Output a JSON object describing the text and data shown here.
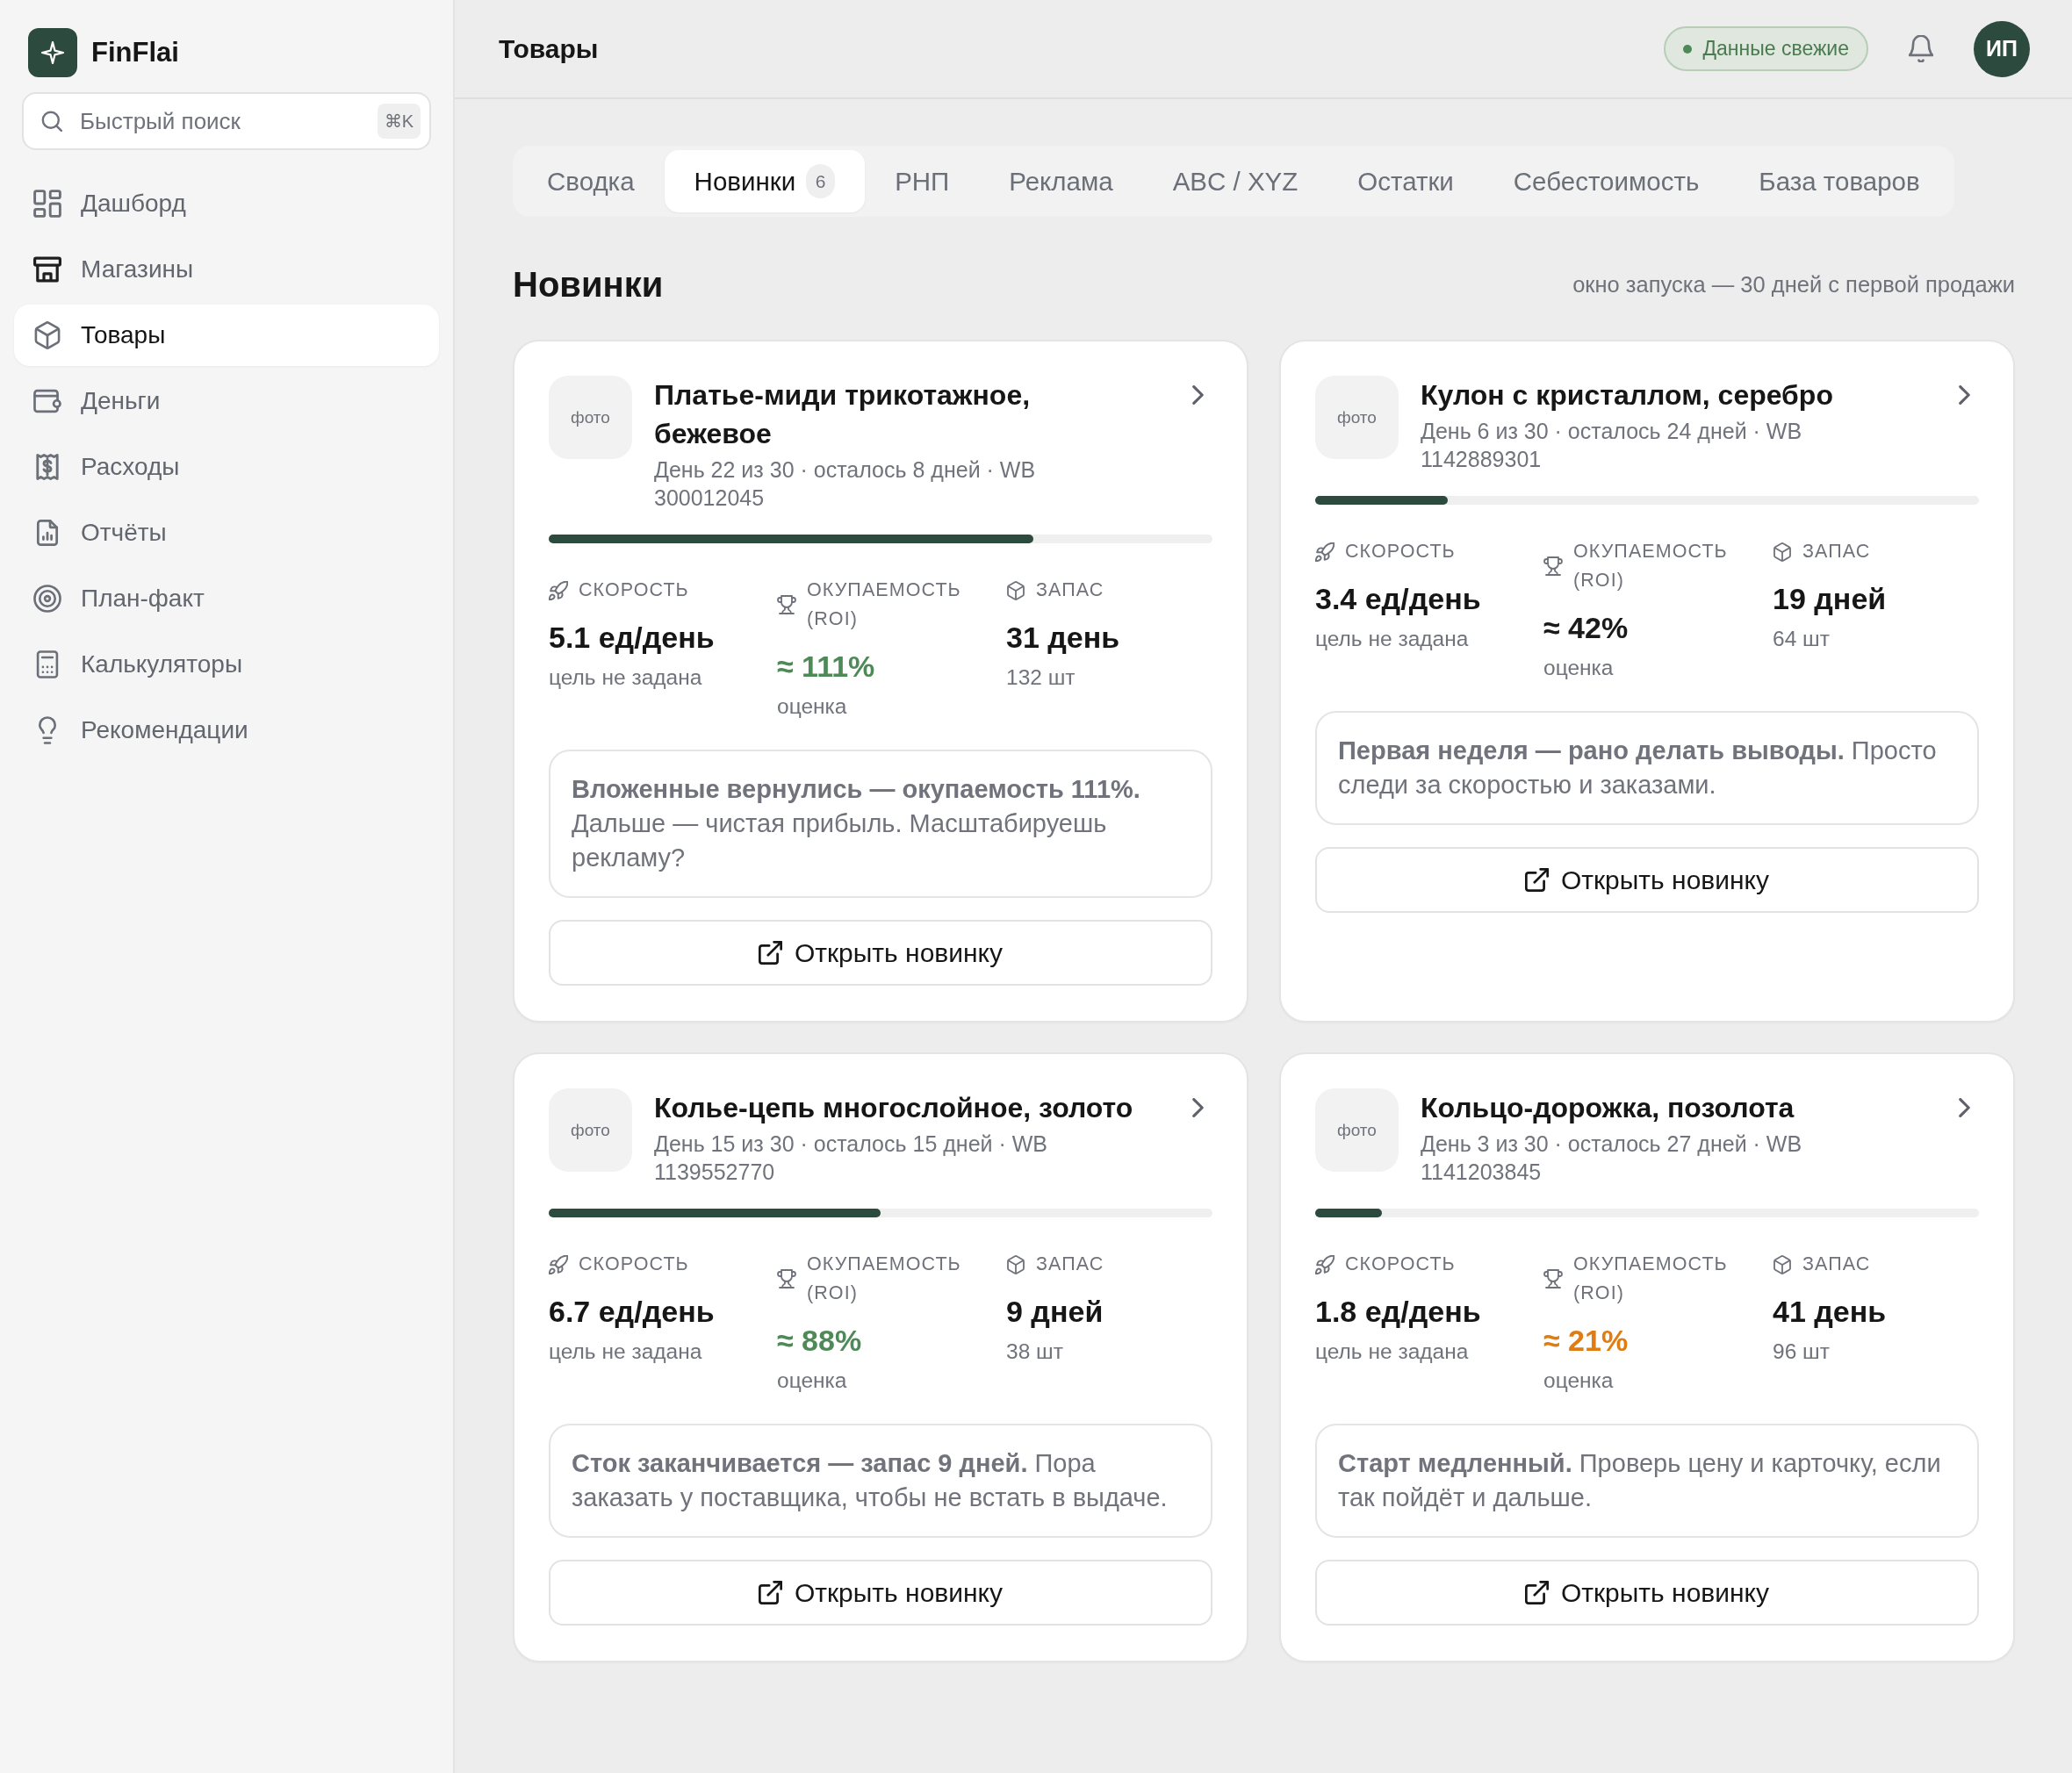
{
  "app": {
    "brand": "FinFlai"
  },
  "sidebar": {
    "search": {
      "placeholder": "Быстрый поиск",
      "shortcut": "⌘K"
    },
    "items": [
      {
        "label": "Дашборд",
        "selected": false
      },
      {
        "label": "Магазины",
        "selected": false
      },
      {
        "label": "Товары",
        "selected": true
      },
      {
        "label": "Деньги",
        "selected": false
      },
      {
        "label": "Расходы",
        "selected": false
      },
      {
        "label": "Отчёты",
        "selected": false
      },
      {
        "label": "План-факт",
        "selected": false
      },
      {
        "label": "Калькуляторы",
        "selected": false
      },
      {
        "label": "Рекомендации",
        "selected": false
      }
    ]
  },
  "header": {
    "title": "Товары",
    "status": "Данные свежие",
    "avatar": "ИП"
  },
  "tabs": [
    {
      "label": "Сводка",
      "selected": false
    },
    {
      "label": "Новинки",
      "selected": true,
      "count": "6"
    },
    {
      "label": "РНП",
      "selected": false
    },
    {
      "label": "Реклама",
      "selected": false
    },
    {
      "label": "ABC / XYZ",
      "selected": false
    },
    {
      "label": "Остатки",
      "selected": false
    },
    {
      "label": "Себестоимость",
      "selected": false
    },
    {
      "label": "База товаров",
      "selected": false
    }
  ],
  "section": {
    "title": "Новинки",
    "hint": "окно запуска — 30 дней с первой продажи"
  },
  "cards": [
    {
      "photo": "фото",
      "title": "Платье-миди трикотажное, бежевое",
      "meta": "День 22 из 30 · осталось 8 дней · WB 300012045",
      "level": 0.73,
      "speed": {
        "label": "СКОРОСТЬ",
        "value": "5.1 ед/день",
        "note": "цель не задана"
      },
      "roi": {
        "label": "ОКУПАЕМОСТЬ (ROI)",
        "value": "≈ 111%",
        "note": "оценка",
        "color": "#4e8a57"
      },
      "stock": {
        "label": "ЗАПАС",
        "value": "31 день",
        "note": "132 шт"
      },
      "advice": "**Вложенные вернулись — окупаемость 111%.** Дальше — чистая прибыль. Масштабируешь рекламу?",
      "button": "Открыть новинку"
    },
    {
      "photo": "фото",
      "title": "Кулон с кристаллом, серебро",
      "meta": "День 6 из 30 · осталось 24 дней · WB 1142889301",
      "level": 0.2,
      "speed": {
        "label": "СКОРОСТЬ",
        "value": "3.4 ед/день",
        "note": "цель не задана"
      },
      "roi": {
        "label": "ОКУПАЕМОСТЬ (ROI)",
        "value": "≈ 42%",
        "note": "оценка",
        "color": "#1a1a1a"
      },
      "stock": {
        "label": "ЗАПАС",
        "value": "19 дней",
        "note": "64 шт"
      },
      "advice": "**Первая неделя — рано делать выводы.** Просто следи за скоростью и заказами.",
      "button": "Открыть новинку"
    },
    {
      "photo": "фото",
      "title": "Колье-цепь многослойное, золото",
      "meta": "День 15 из 30 · осталось 15 дней · WB 1139552770",
      "level": 0.5,
      "speed": {
        "label": "СКОРОСТЬ",
        "value": "6.7 ед/день",
        "note": "цель не задана"
      },
      "roi": {
        "label": "ОКУПАЕМОСТЬ (ROI)",
        "value": "≈ 88%",
        "note": "оценка",
        "color": "#4e8a57"
      },
      "stock": {
        "label": "ЗАПАС",
        "value": "9 дней",
        "note": "38 шт"
      },
      "advice": "**Сток заканчивается — запас 9 дней.** Пора заказать у поставщика, чтобы не встать в выдаче.",
      "button": "Открыть новинку"
    },
    {
      "photo": "фото",
      "title": "Кольцо-дорожка, позолота",
      "meta": "День 3 из 30 · осталось 27 дней · WB 1141203845",
      "level": 0.1,
      "speed": {
        "label": "СКОРОСТЬ",
        "value": "1.8 ед/день",
        "note": "цель не задана"
      },
      "roi": {
        "label": "ОКУПАЕМОСТЬ (ROI)",
        "value": "≈ 21%",
        "note": "оценка",
        "color": "#e07d12"
      },
      "stock": {
        "label": "ЗАПАС",
        "value": "41 день",
        "note": "96 шт"
      },
      "advice": "**Старт медленный.** Проверь цену и карточку, если так пойдёт и дальше.",
      "button": "Открыть новинку"
    }
  ]
}
